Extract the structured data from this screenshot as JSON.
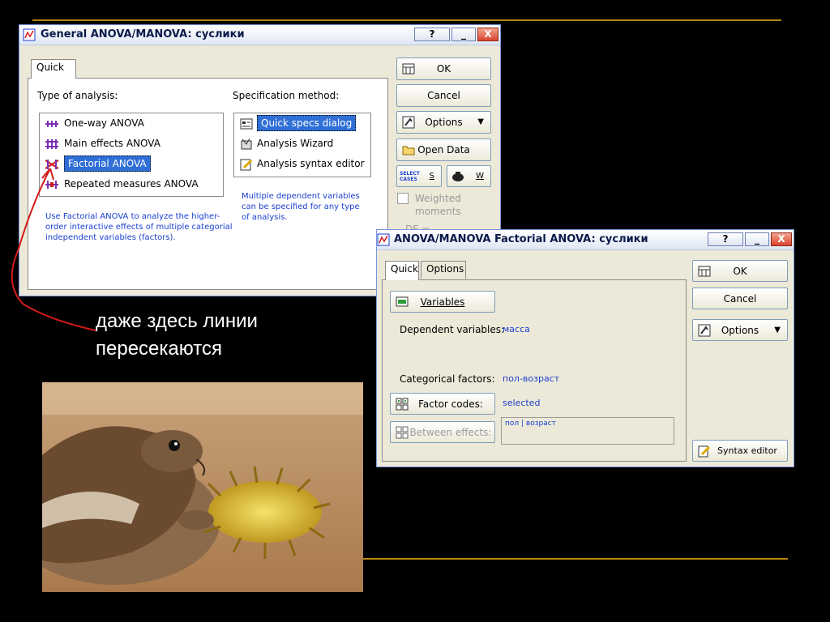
{
  "annotation": {
    "caption_line1": "даже здесь линии",
    "caption_line2": "пересекаются"
  },
  "window1": {
    "title": "General ANOVA/MANOVA: суслики",
    "title_buttons": [
      "?",
      "_",
      "X"
    ],
    "tab_quick": "Quick",
    "type_label": "Type of analysis:",
    "analyses": [
      "One-way ANOVA",
      "Main effects ANOVA",
      "Factorial ANOVA",
      "Repeated measures ANOVA"
    ],
    "selected_analysis": "Factorial ANOVA",
    "help_text": "Use Factorial ANOVA to analyze the higher-order interactive effects of multiple categorial independent variables (factors).",
    "spec_label": "Specification method:",
    "spec_methods": [
      "Quick specs dialog",
      "Analysis Wizard",
      "Analysis syntax editor"
    ],
    "selected_spec": "Quick specs dialog",
    "spec_note": "Multiple dependent variables can be specified for any type of analysis.",
    "ok": "OK",
    "cancel": "Cancel",
    "options": "Options",
    "open_data": "Open Data",
    "select_cases_icon_text": "SELECT CASES",
    "select_cases_key": "S",
    "weight_key": "W",
    "weighted_moments": "Weighted moments",
    "df_partial": "DF ="
  },
  "window2": {
    "title": "ANOVA/MANOVA Factorial ANOVA: суслики",
    "title_buttons": [
      "?",
      "_",
      "X"
    ],
    "tab_quick": "Quick",
    "tab_options": "Options",
    "variables_btn": "Variables",
    "dependent_label": "Dependent variables:",
    "dependent_value": "масса",
    "categorical_label": "Categorical factors:",
    "categorical_value": "пол-возраст",
    "factor_codes_btn": "Factor codes:",
    "factor_codes_value": "selected",
    "between_effects_btn": "Between effects:",
    "between_effects_value": "пол | возраст",
    "ok": "OK",
    "cancel": "Cancel",
    "options": "Options",
    "syntax_editor": "Syntax editor"
  },
  "colors": {
    "accent_rule": "#b8860b",
    "highlight": "#2f6fd6",
    "arrow": "#d11a1a"
  }
}
